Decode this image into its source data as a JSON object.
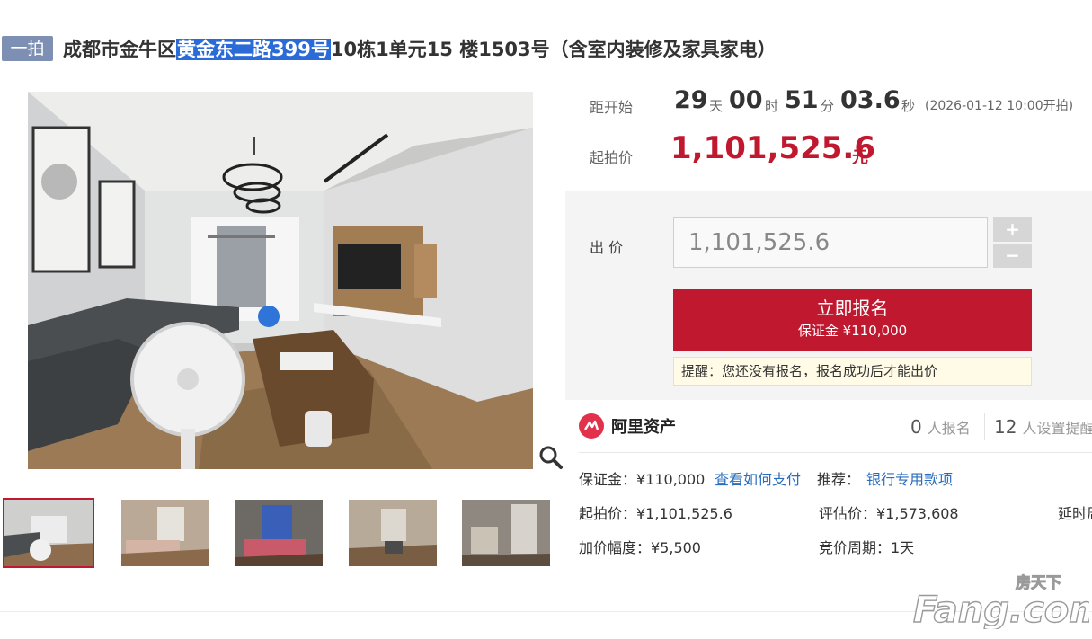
{
  "title": {
    "badge": "一拍",
    "prefix": "成都市金牛区",
    "highlight": "黄金东二路399号",
    "suffix": "10栋1单元15 楼1503号（含室内装修及家具家电）"
  },
  "countdown": {
    "label": "距开始",
    "days": "29",
    "days_unit": "天",
    "hours": "00",
    "hours_unit": "时",
    "minutes": "51",
    "minutes_unit": "分",
    "seconds": "03.6",
    "seconds_unit": "秒",
    "start_note": "(2026-01-12 10:00开拍)"
  },
  "start_price": {
    "label": "起拍价",
    "value": "1,101,525.6",
    "unit": "元"
  },
  "bid": {
    "label": "出 价",
    "input_value": "1,101,525.6",
    "plus": "+",
    "minus": "−"
  },
  "signup": {
    "label": "立即报名",
    "deposit": "保证金 ¥110,000"
  },
  "notice": "提醒：您还没有报名，报名成功后才能出价",
  "platform": {
    "name": "阿里资产"
  },
  "counts": {
    "signed_num": "0",
    "signed_label": "人报名",
    "remind_num": "12",
    "remind_label": "人设置提醒"
  },
  "info": {
    "deposit_label": "保证金：¥110,000",
    "how_to_pay": "查看如何支付",
    "recommend_label": "推荐：",
    "recommend_link": "银行专用款项",
    "start_price": "起拍价：¥1,101,525.6",
    "eval_price": "评估价：¥1,573,608",
    "delay": "延时周",
    "increment": "加价幅度：¥5,500",
    "period": "竞价周期：1天"
  },
  "watermark": {
    "top": "房天下",
    "main": "Fang.com"
  },
  "colors": {
    "accent": "#c0182f",
    "badge": "#7d8fb3",
    "link": "#2a6ebd",
    "highlight": "#2b6bd8"
  }
}
